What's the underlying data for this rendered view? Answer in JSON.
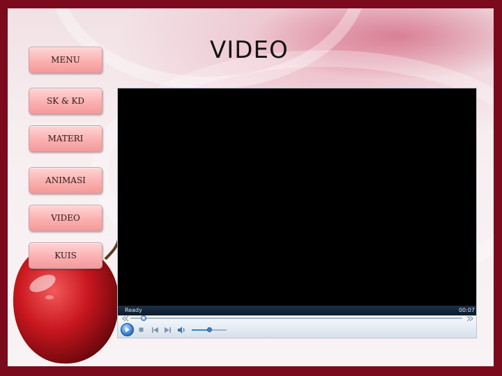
{
  "page": {
    "title": "VIDEO"
  },
  "nav": {
    "items": [
      {
        "label": "MENU"
      },
      {
        "label": "SK & KD"
      },
      {
        "label": "MATERI"
      },
      {
        "label": "ANIMASI"
      },
      {
        "label": "VIDEO"
      },
      {
        "label": "KUIS"
      }
    ]
  },
  "player": {
    "status": "Ready",
    "time": "00:07",
    "seek_position_fraction": 0.04,
    "volume_fraction": 0.5,
    "controls": [
      "play-icon",
      "stop-icon",
      "previous-icon",
      "next-icon",
      "volume-icon"
    ]
  },
  "colors": {
    "frame": "#7a0a1c",
    "button_gradient_top": "#ffd5d5",
    "button_gradient_bottom": "#f49a9a",
    "player_accent": "#3d86d6"
  }
}
